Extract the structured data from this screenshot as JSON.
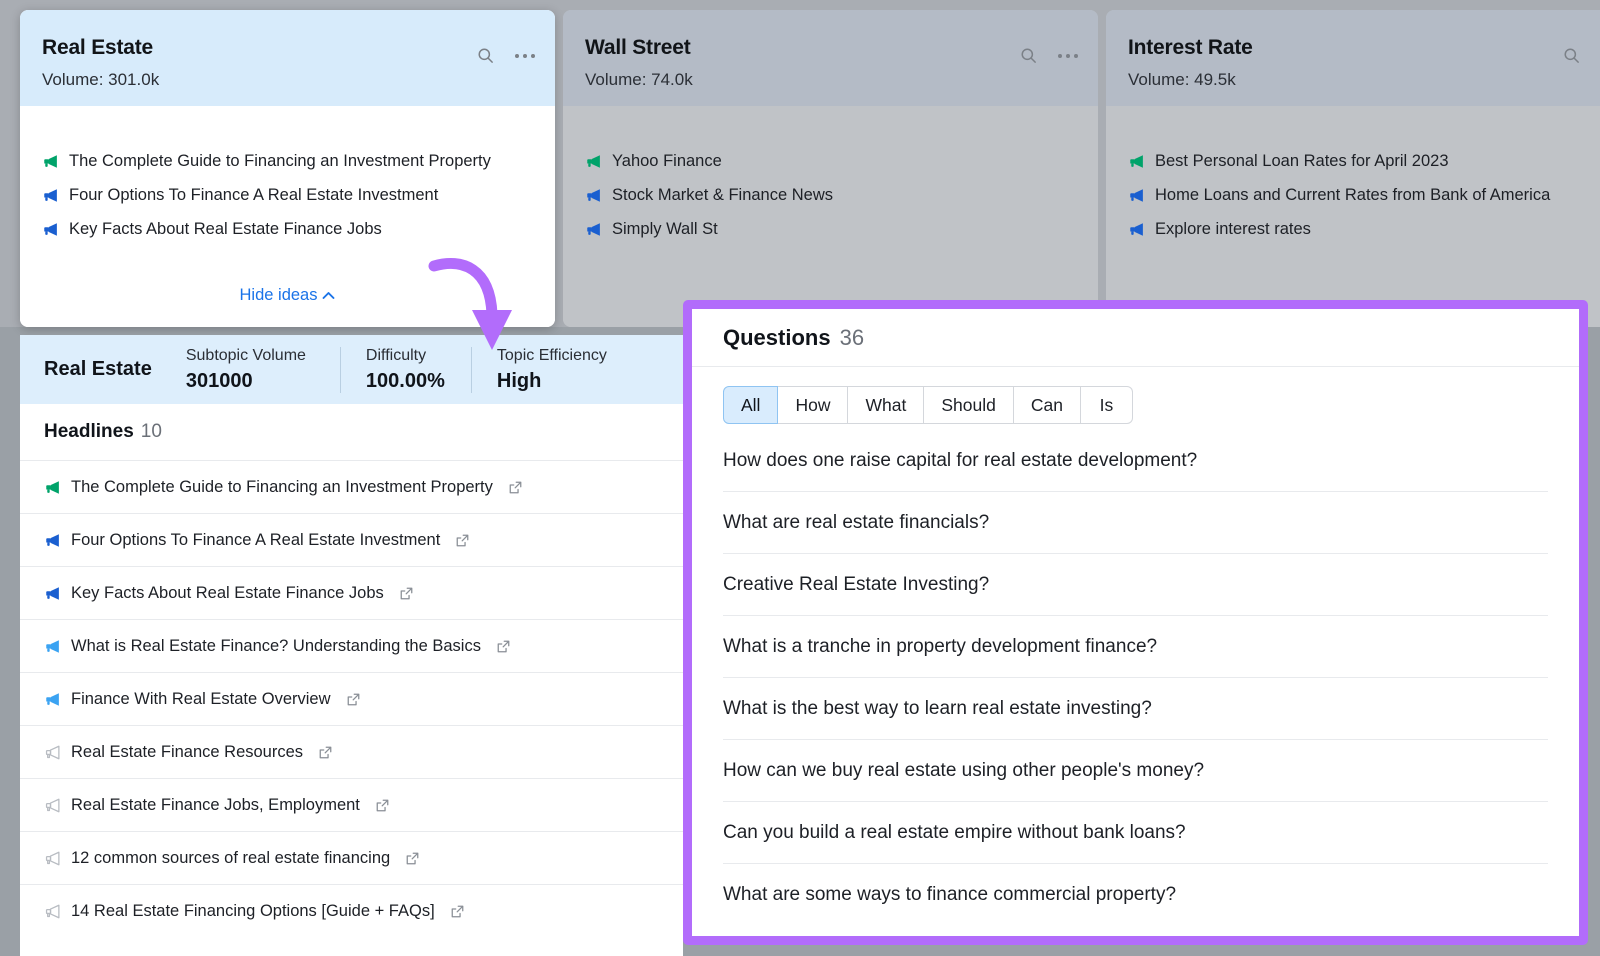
{
  "colors": {
    "accent_purple": "#b26cfb",
    "link_blue": "#1a73e8",
    "active_card_header": "#d7ebfb",
    "metrics_bar": "#ddeefc",
    "megaphone_green": "#00a36a",
    "megaphone_blue": "#1a5fd0",
    "megaphone_lightblue": "#3ba3f2",
    "megaphone_gray": "#b8bcc2"
  },
  "cards": [
    {
      "title": "Real Estate",
      "volume_label": "Volume: 301.0k",
      "active": true,
      "search_icon": "search-icon",
      "more_icon": "more-options-icon",
      "hide_ideas_label": "Hide ideas",
      "ideas": [
        {
          "text": "The Complete Guide to Financing an Investment Property",
          "icon": "megaphone-icon",
          "tone": "green"
        },
        {
          "text": "Four Options To Finance A Real Estate Investment",
          "icon": "megaphone-icon",
          "tone": "blue"
        },
        {
          "text": "Key Facts About Real Estate Finance Jobs",
          "icon": "megaphone-icon",
          "tone": "blue"
        }
      ]
    },
    {
      "title": "Wall Street",
      "volume_label": "Volume: 74.0k",
      "active": false,
      "search_icon": "search-icon",
      "more_icon": "more-options-icon",
      "ideas": [
        {
          "text": "Yahoo Finance",
          "icon": "megaphone-icon",
          "tone": "green"
        },
        {
          "text": "Stock Market & Finance News",
          "icon": "megaphone-icon",
          "tone": "blue"
        },
        {
          "text": "Simply Wall St",
          "icon": "megaphone-icon",
          "tone": "blue"
        }
      ]
    },
    {
      "title": "Interest Rate",
      "volume_label": "Volume: 49.5k",
      "active": false,
      "search_icon": "search-icon",
      "more_icon": "more-options-icon",
      "ideas": [
        {
          "text": "Best Personal Loan Rates for April 2023",
          "icon": "megaphone-icon",
          "tone": "green"
        },
        {
          "text": "Home Loans and Current Rates from Bank of America",
          "icon": "megaphone-icon",
          "tone": "blue"
        },
        {
          "text": "Explore interest rates",
          "icon": "megaphone-icon",
          "tone": "blue"
        }
      ]
    }
  ],
  "detail": {
    "topic_name": "Real Estate",
    "metrics": [
      {
        "name": "Subtopic Volume",
        "value": "301000"
      },
      {
        "name": "Difficulty",
        "value": "100.00%"
      },
      {
        "name": "Topic Efficiency",
        "value": "High"
      }
    ],
    "headlines_label": "Headlines",
    "headlines_count": "10",
    "headlines": [
      {
        "text": "The Complete Guide to Financing an Investment Property",
        "tone": "green"
      },
      {
        "text": "Four Options To Finance A Real Estate Investment",
        "tone": "blue"
      },
      {
        "text": "Key Facts About Real Estate Finance Jobs",
        "tone": "blue"
      },
      {
        "text": "What is Real Estate Finance? Understanding the Basics",
        "tone": "lightblue"
      },
      {
        "text": "Finance With Real Estate Overview",
        "tone": "lightblue"
      },
      {
        "text": "Real Estate Finance Resources",
        "tone": "gray"
      },
      {
        "text": "Real Estate Finance Jobs, Employment",
        "tone": "gray"
      },
      {
        "text": "12 common sources of real estate financing",
        "tone": "gray"
      },
      {
        "text": "14 Real Estate Financing Options [Guide + FAQs]",
        "tone": "gray"
      }
    ]
  },
  "questions": {
    "title": "Questions",
    "count": "36",
    "filters": [
      "All",
      "How",
      "What",
      "Should",
      "Can",
      "Is"
    ],
    "selected_filter": "All",
    "items": [
      "How does one raise capital for real estate development?",
      "What are real estate financials?",
      "Creative Real Estate Investing?",
      "What is a tranche in property development finance?",
      "What is the best way to learn real estate investing?",
      "How can we buy real estate using other people's money?",
      "Can you build a real estate empire without bank loans?",
      "What are some ways to finance commercial property?"
    ]
  },
  "annotation": {
    "arrow_icon": "curved-down-arrow-icon"
  }
}
